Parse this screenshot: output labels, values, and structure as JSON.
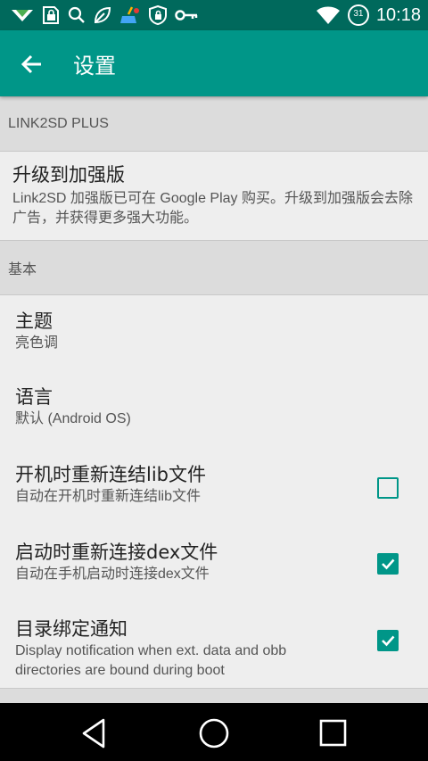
{
  "status_bar": {
    "time": "10:18",
    "calendar_day": "31",
    "icons": [
      "signal-arrow-icon",
      "lock-app-icon",
      "search-icon",
      "leaf-icon",
      "cleaner-icon",
      "shield-icon",
      "key-icon",
      "wifi-icon",
      "calendar-icon"
    ]
  },
  "app_bar": {
    "title": "设置",
    "back_icon": "arrow-back-icon"
  },
  "categories": {
    "plus": "LINK2SD PLUS",
    "basic": "基本"
  },
  "prefs": {
    "upgrade": {
      "title": "升级到加强版",
      "summary": "Link2SD 加强版已可在 Google Play 购买。升级到加强版会去除广告，并获得更多强大功能。"
    },
    "theme": {
      "title": "主题",
      "summary": "亮色调"
    },
    "language": {
      "title": "语言",
      "summary": "默认 (Android OS)"
    },
    "relink_lib": {
      "title": "开机时重新连结lib文件",
      "summary": "自动在开机时重新连结lib文件",
      "checked": false
    },
    "relink_dex": {
      "title": "启动时重新连接dex文件",
      "summary": "自动在手机启动时连接dex文件",
      "checked": true
    },
    "bind_notify": {
      "title": "目录绑定通知",
      "summary": "Display notification when ext. data and obb directories are bound during boot",
      "checked": true
    }
  },
  "colors": {
    "primary": "#009688",
    "primary_dark": "#00695c",
    "background": "#eeeeee",
    "category_bg": "#dcdcdc"
  },
  "nav_bar": {
    "back_icon": "nav-back-icon",
    "home_icon": "nav-home-icon",
    "recents_icon": "nav-recents-icon"
  }
}
